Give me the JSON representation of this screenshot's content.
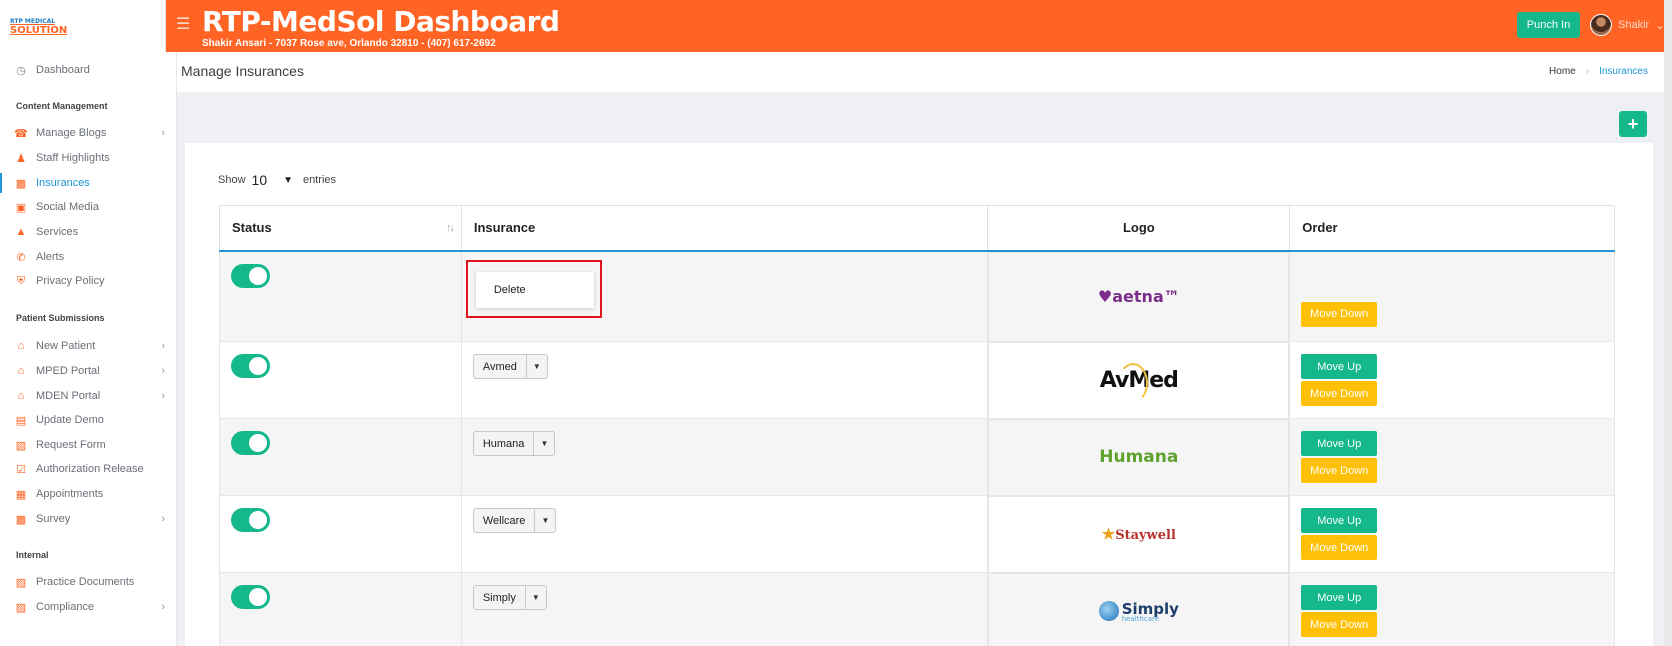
{
  "header": {
    "logo_line1": "RTP MEDICAL",
    "logo_line2": "SOLUTION",
    "title": "RTP-MedSol Dashboard",
    "subtitle": "Shakir Ansari - 7037 Rose ave, Orlando 32810 - (407) 617-2692",
    "punch_label": "Punch In",
    "user_name": "Shakir",
    "accent_color": "#ff6424"
  },
  "sidebar": {
    "dashboard": "Dashboard",
    "sections": {
      "content": "Content Management",
      "patient": "Patient Submissions",
      "internal": "Internal"
    },
    "items": [
      {
        "label": "Manage Blogs",
        "icon": "blog-icon"
      },
      {
        "label": "Staff Highlights",
        "icon": "staff-icon"
      },
      {
        "label": "Insurances",
        "icon": "insurance-icon"
      },
      {
        "label": "Social Media",
        "icon": "social-icon"
      },
      {
        "label": "Services",
        "icon": "services-icon"
      },
      {
        "label": "Alerts",
        "icon": "phone-icon"
      },
      {
        "label": "Privacy Policy",
        "icon": "shield-icon"
      },
      {
        "label": "New Patient",
        "icon": "home-icon"
      },
      {
        "label": "MPED Portal",
        "icon": "home-icon"
      },
      {
        "label": "MDEN Portal",
        "icon": "home-icon"
      },
      {
        "label": "Update Demo",
        "icon": "id-card-icon"
      },
      {
        "label": "Request Form",
        "icon": "form-icon"
      },
      {
        "label": "Authorization Release",
        "icon": "clipboard-check-icon"
      },
      {
        "label": "Appointments",
        "icon": "calendar-icon"
      },
      {
        "label": "Survey",
        "icon": "chart-icon"
      },
      {
        "label": "Practice Documents",
        "icon": "clipboard-icon"
      },
      {
        "label": "Compliance",
        "icon": "compliance-icon"
      }
    ]
  },
  "page": {
    "title": "Manage Insurances",
    "breadcrumb_home": "Home",
    "breadcrumb_current": "Insurances",
    "add_label": "+"
  },
  "table": {
    "show_label": "Show",
    "show_value": "10",
    "entries_label": "entries",
    "columns": [
      "Status",
      "Insurance",
      "Logo",
      "Order"
    ],
    "dropdown_item": "Delete",
    "move_up": "Move Up",
    "move_down": "Move Down",
    "rows": [
      {
        "name": "Aetna",
        "logo_text": "♥aetna™"
      },
      {
        "name": "Avmed",
        "logo_text": "AvMed"
      },
      {
        "name": "Humana",
        "logo_text": "Humana"
      },
      {
        "name": "Wellcare",
        "logo_text": "Staywell"
      },
      {
        "name": "Simply",
        "logo_text": "Simply",
        "logo_sub": "healthcare"
      }
    ]
  }
}
